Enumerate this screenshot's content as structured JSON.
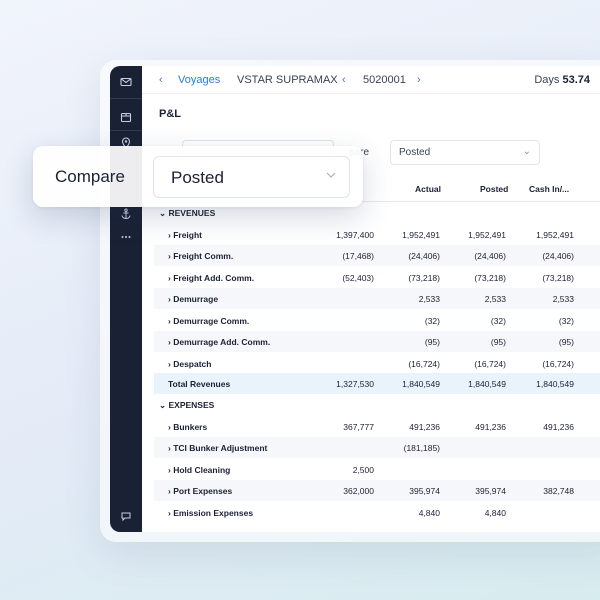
{
  "breadcrumb": {
    "voyages": "Voyages",
    "vessel": "VSTAR SUPRAMAX",
    "voyage_no": "5020001",
    "days_label": "Days",
    "days_value": "53.74"
  },
  "page_title": "P&L",
  "compare_small": {
    "label": "pare",
    "value": "Posted"
  },
  "compare_popup": {
    "label": "Compare",
    "value": "Posted"
  },
  "columns": [
    "ted",
    "Actual",
    "Posted",
    "Cash In/..."
  ],
  "sections": {
    "revenues": "REVENUES",
    "expenses": "EXPENSES"
  },
  "revenue_rows": [
    {
      "label": "Freight",
      "values": [
        "1,397,400",
        "1,952,491",
        "1,952,491",
        "1,952,491"
      ]
    },
    {
      "label": "Freight Comm.",
      "values": [
        "(17,468)",
        "(24,406)",
        "(24,406)",
        "(24,406)"
      ]
    },
    {
      "label": "Freight Add. Comm.",
      "values": [
        "(52,403)",
        "(73,218)",
        "(73,218)",
        "(73,218)"
      ]
    },
    {
      "label": "Demurrage",
      "values": [
        "",
        "2,533",
        "2,533",
        "2,533"
      ]
    },
    {
      "label": "Demurrage Comm.",
      "values": [
        "",
        "(32)",
        "(32)",
        "(32)"
      ]
    },
    {
      "label": "Demurrage Add. Comm.",
      "values": [
        "",
        "(95)",
        "(95)",
        "(95)"
      ]
    },
    {
      "label": "Despatch",
      "values": [
        "",
        "(16,724)",
        "(16,724)",
        "(16,724)"
      ]
    }
  ],
  "total_revenues": {
    "label": "Total Revenues",
    "values": [
      "1,327,530",
      "1,840,549",
      "1,840,549",
      "1,840,549"
    ]
  },
  "expense_rows": [
    {
      "label": "Bunkers",
      "values": [
        "367,777",
        "491,236",
        "491,236",
        "491,236"
      ]
    },
    {
      "label": "TCI Bunker Adjustment",
      "values": [
        "",
        "(181,185)",
        "",
        ""
      ]
    },
    {
      "label": "Hold Cleaning",
      "values": [
        "2,500",
        "",
        "",
        ""
      ]
    },
    {
      "label": "Port Expenses",
      "values": [
        "362,000",
        "395,974",
        "395,974",
        "382,748"
      ]
    },
    {
      "label": "Emission Expenses",
      "values": [
        "",
        "4,840",
        "4,840",
        ""
      ]
    }
  ],
  "sidebar_icons": [
    "mail-icon",
    "box-icon",
    "location-pin-icon",
    "anchor-icon",
    "more-dots-icon",
    "chat-icon"
  ],
  "colors": {
    "accent": "#2b7bd6",
    "sidebar": "#1b2135",
    "total_row": "#e9f3fb"
  }
}
